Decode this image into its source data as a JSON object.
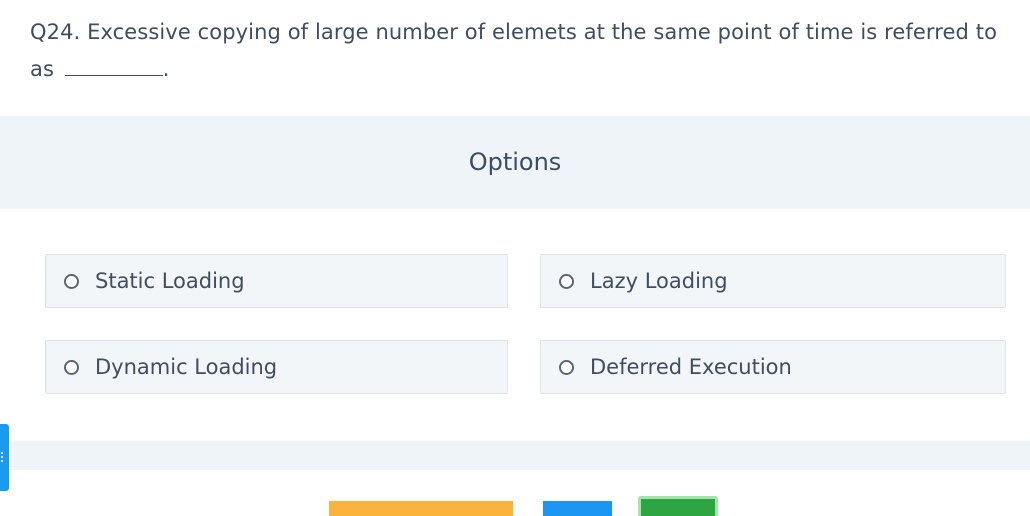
{
  "question": {
    "text": "Q24. Excessive copying of large number of elemets at the same point of time is referred to as",
    "suffix": "."
  },
  "options_section": {
    "title": "Options"
  },
  "options": [
    {
      "label": "Static Loading",
      "selected": false
    },
    {
      "label": "Lazy Loading",
      "selected": false
    },
    {
      "label": "Dynamic Loading",
      "selected": false
    },
    {
      "label": "Deferred Execution",
      "selected": false
    }
  ],
  "colors": {
    "band_background": "#eef4f7",
    "option_background": "#f2f6f8",
    "text": "#3f4d62",
    "button_yellow": "#fbb23b",
    "button_blue": "#1a96f2",
    "button_green": "#2da641",
    "side_tab": "#1a9bef"
  }
}
